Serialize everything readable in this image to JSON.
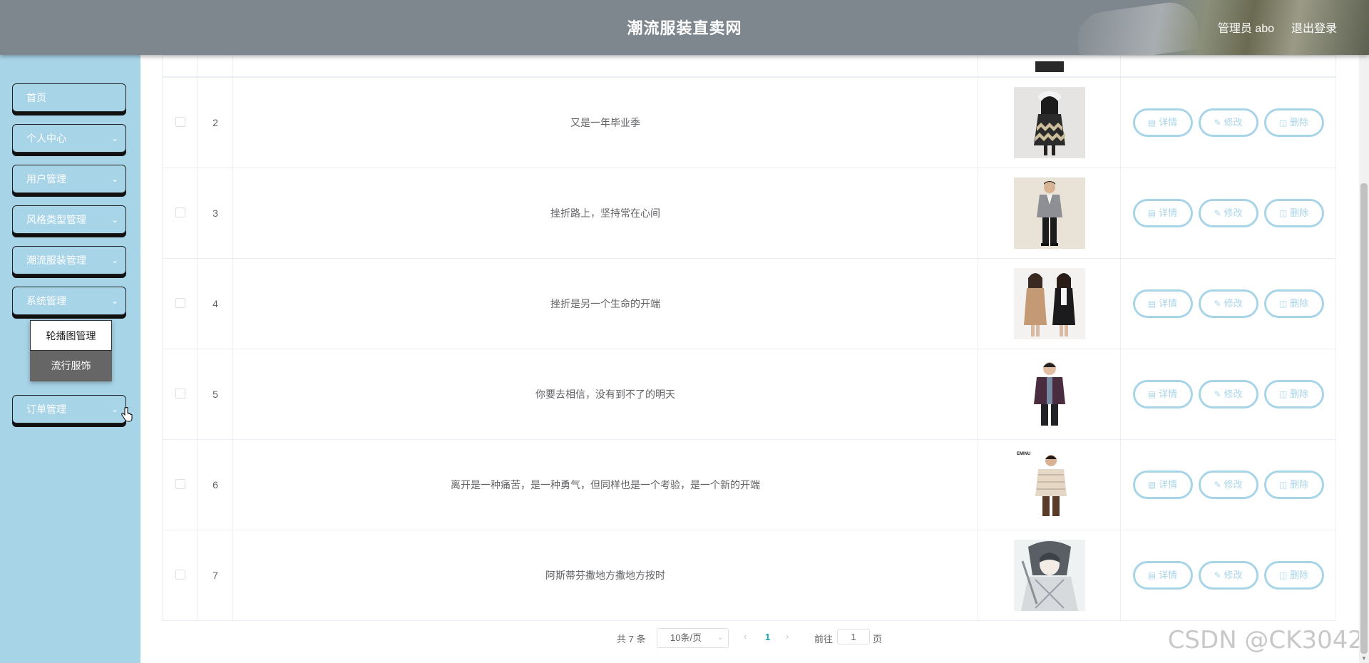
{
  "header": {
    "title": "潮流服装直卖网",
    "user": "管理员 abo",
    "logout": "退出登录"
  },
  "sidebar": {
    "items": [
      {
        "label": "首页",
        "chevron": false
      },
      {
        "label": "个人中心",
        "chevron": true
      },
      {
        "label": "用户管理",
        "chevron": true
      },
      {
        "label": "风格类型管理",
        "chevron": true
      },
      {
        "label": "潮流服装管理",
        "chevron": true
      },
      {
        "label": "系统管理",
        "chevron": true
      },
      {
        "label": "订单管理",
        "chevron": true
      }
    ],
    "submenu": [
      "轮播图管理",
      "流行服饰"
    ]
  },
  "table": {
    "rows": [
      {
        "index": "2",
        "title": "又是一年毕业季",
        "image": "girl-knit-dress"
      },
      {
        "index": "3",
        "title": "挫折路上，坚持常在心间",
        "image": "man-grey-suit"
      },
      {
        "index": "4",
        "title": "挫折是另一个生命的开端",
        "image": "two-women-coats"
      },
      {
        "index": "5",
        "title": "你要去相信，没有到不了的明天",
        "image": "man-purple-jacket"
      },
      {
        "index": "6",
        "title": "离开是一种痛苦，是一种勇气，但同样也是一个考验，是一个新的开端",
        "image": "man-puffer-jacket"
      },
      {
        "index": "7",
        "title": "阿斯蒂芬撒地方撒地方按时",
        "image": "anime-swordsman"
      }
    ],
    "actions": {
      "detail": "详情",
      "edit": "修改",
      "delete": "删除"
    },
    "partial_image_label": "EMINU"
  },
  "pagination": {
    "total": "共 7 条",
    "page_size": "10条/页",
    "current": "1",
    "goto": "前往",
    "goto_value": "1",
    "unit": "页"
  },
  "watermark": "CSDN @CK3042",
  "colors": {
    "header": "#7e878e",
    "sidebar": "#a8d4e8",
    "accent": "#1aa3ad"
  }
}
